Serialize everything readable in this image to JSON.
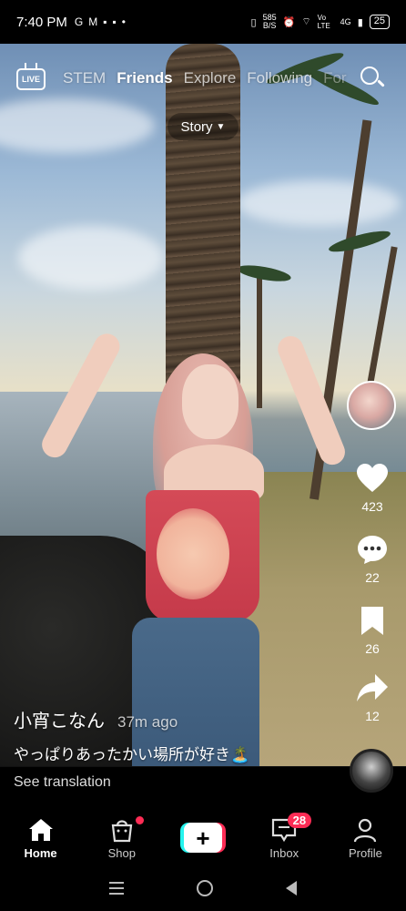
{
  "status_bar": {
    "time": "7:40 PM",
    "net_speed_value": "585",
    "net_speed_unit": "B/S",
    "volte": "Vo LTE",
    "network": "4G",
    "battery": "25"
  },
  "top_nav": {
    "live_label": "LIVE",
    "tabs": [
      "STEM",
      "Friends",
      "Explore",
      "Following",
      "For"
    ],
    "active_tab": "Friends"
  },
  "story_pill": {
    "label": "Story"
  },
  "side_actions": {
    "likes": "423",
    "comments": "22",
    "saves": "26",
    "shares": "12"
  },
  "video": {
    "author": "小宵こなん",
    "time_ago": "37m ago",
    "caption": "やっぱりあったかい場所が好き🏝️",
    "see_translation": "See translation"
  },
  "bottom_nav": {
    "home": "Home",
    "shop": "Shop",
    "create": "+",
    "inbox": "Inbox",
    "inbox_badge": "28",
    "profile": "Profile"
  },
  "colors": {
    "accent_red": "#fe2c55",
    "accent_cyan": "#25f4ee"
  }
}
